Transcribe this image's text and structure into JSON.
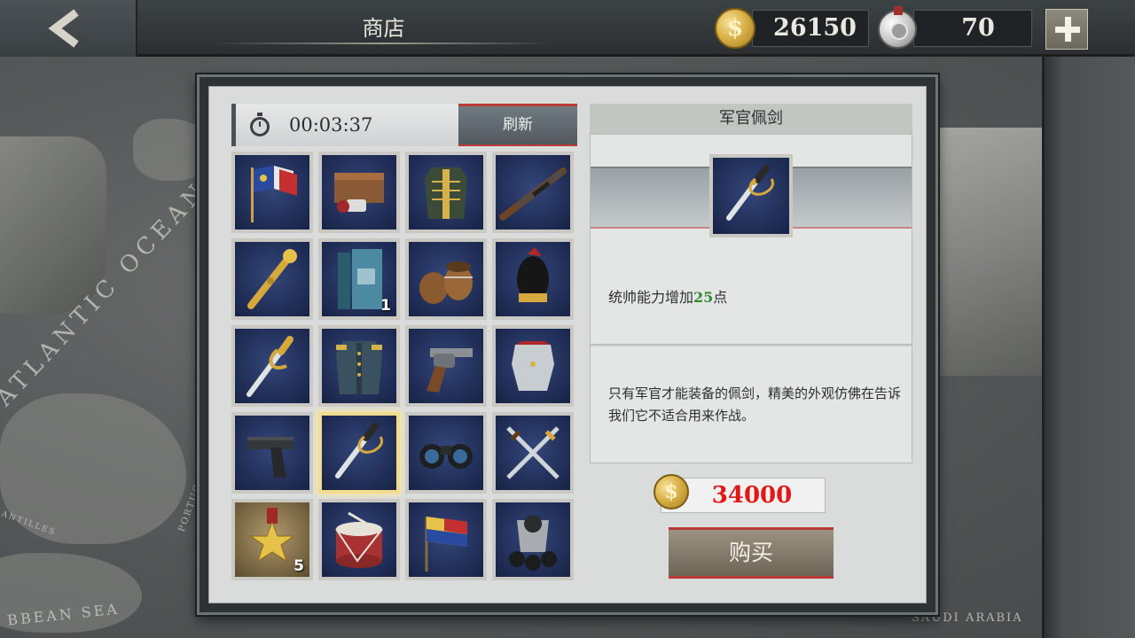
{
  "header": {
    "title": "商店",
    "gold": {
      "icon": "gold-coin-icon",
      "value": "26150"
    },
    "medals": {
      "icon": "silver-medal-icon",
      "value": "70"
    },
    "back_icon": "back-arrow-icon",
    "add_icon": "plus-icon"
  },
  "map": {
    "labels": [
      "ATLANTIC OCEAN",
      "BBEAN SEA",
      "SAUDI ARABIA",
      "PORTUGAL",
      "ANTILLES"
    ]
  },
  "shop": {
    "timer": "00:03:37",
    "refresh_label": "刷新",
    "items": [
      {
        "name": "flags",
        "qty": ""
      },
      {
        "name": "ammo-crate",
        "qty": ""
      },
      {
        "name": "hussar-jacket",
        "qty": ""
      },
      {
        "name": "rifle",
        "qty": ""
      },
      {
        "name": "marshal-baton",
        "qty": ""
      },
      {
        "name": "books",
        "qty": "1"
      },
      {
        "name": "barrels",
        "qty": ""
      },
      {
        "name": "bearskin-hat",
        "qty": ""
      },
      {
        "name": "gold-sabre",
        "qty": ""
      },
      {
        "name": "officer-coat",
        "qty": ""
      },
      {
        "name": "revolver",
        "qty": ""
      },
      {
        "name": "cuirass",
        "qty": ""
      },
      {
        "name": "pistol",
        "qty": ""
      },
      {
        "name": "officer-sword",
        "qty": "",
        "selected": true
      },
      {
        "name": "binoculars",
        "qty": ""
      },
      {
        "name": "daggers",
        "qty": ""
      },
      {
        "name": "star-medal",
        "qty": "5"
      },
      {
        "name": "drum",
        "qty": ""
      },
      {
        "name": "signal-flags",
        "qty": ""
      },
      {
        "name": "cannonballs",
        "qty": ""
      }
    ]
  },
  "detail": {
    "title": "军官佩剑",
    "effect_prefix": "统帅能力增加",
    "effect_value": "25",
    "effect_suffix": "点",
    "description": "只有军官才能装备的佩剑，精美的外观仿佛在告诉我们它不适合用来作战。",
    "price": "34000",
    "buy_label": "购买"
  },
  "colors": {
    "price_red": "#e01818",
    "effect_green": "#2f8a2b",
    "accent_red": "#b73b36",
    "gold": "#d9b24a"
  }
}
